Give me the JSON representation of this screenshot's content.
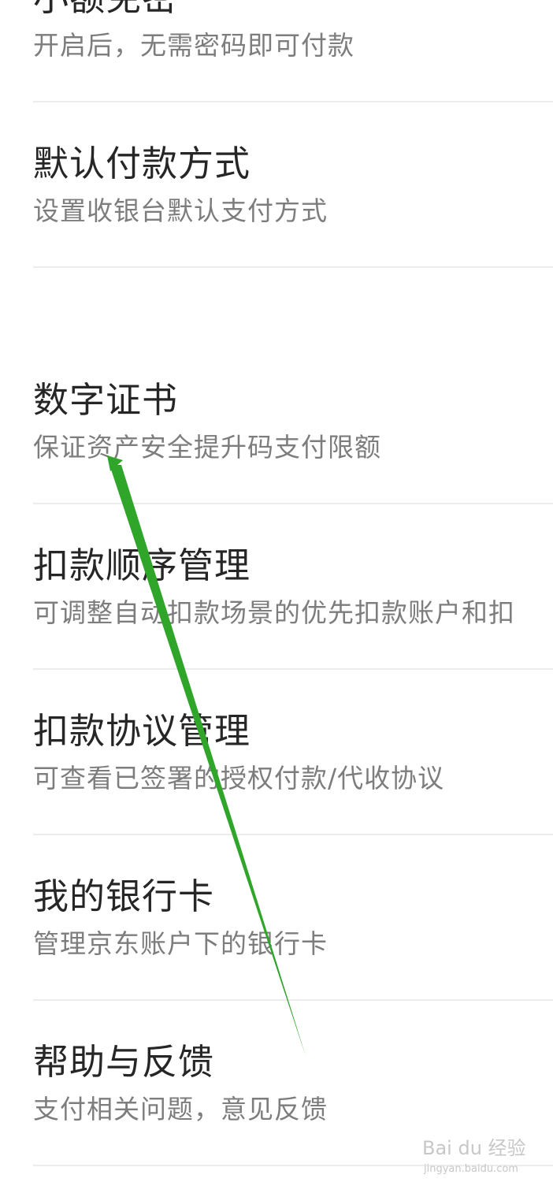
{
  "settings": {
    "items": [
      {
        "title": "小额免密",
        "subtitle": "开启后，无需密码即可付款"
      },
      {
        "title": "默认付款方式",
        "subtitle": "设置收银台默认支付方式"
      },
      {
        "title": "数字证书",
        "subtitle": "保证资产安全提升码支付限额"
      },
      {
        "title": "扣款顺序管理",
        "subtitle": "可调整自动扣款场景的优先扣款账户和扣"
      },
      {
        "title": "扣款协议管理",
        "subtitle": "可查看已签署的授权付款/代收协议"
      },
      {
        "title": "我的银行卡",
        "subtitle": "管理京东账户下的银行卡"
      },
      {
        "title": "帮助与反馈",
        "subtitle": "支付相关问题，意见反馈"
      }
    ]
  },
  "annotation": {
    "color": "#2fa52a"
  },
  "watermark": {
    "main": "Bai du 经验",
    "sub": "jingyan.baidu.com"
  }
}
